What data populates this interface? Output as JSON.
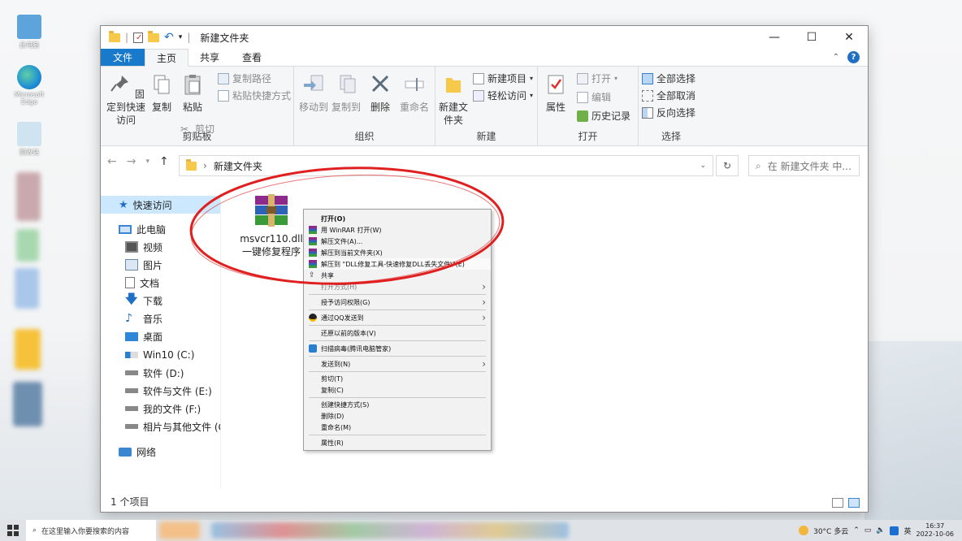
{
  "desktop": {
    "icons": [
      {
        "label": "此电脑",
        "color": "#5ea4dc"
      },
      {
        "label": "Microsoft Edge",
        "color": "#1f8fd6"
      },
      {
        "label": "回收站",
        "color": "#7fb6d8"
      }
    ]
  },
  "window": {
    "title": "新建文件夹",
    "controls": {
      "minimize": "—",
      "maximize": "☐",
      "close": "✕"
    }
  },
  "tabs": [
    "文件",
    "主页",
    "共享",
    "查看"
  ],
  "ribbon": {
    "clipboard": {
      "label": "剪贴板",
      "pin": "固定到快速访问",
      "copy": "复制",
      "paste": "粘贴",
      "copy_path": "复制路径",
      "paste_shortcut": "粘贴快捷方式",
      "cut": "剪切"
    },
    "organize": {
      "label": "组织",
      "move_to": "移动到",
      "copy_to": "复制到",
      "delete": "删除",
      "rename": "重命名"
    },
    "new": {
      "label": "新建",
      "new_folder": "新建文件夹",
      "new_item": "新建项目",
      "easy_access": "轻松访问"
    },
    "open": {
      "label": "打开",
      "properties": "属性",
      "open": "打开",
      "edit": "编辑",
      "history": "历史记录"
    },
    "select": {
      "label": "选择",
      "select_all": "全部选择",
      "select_none": "全部取消",
      "invert": "反向选择"
    }
  },
  "address": {
    "path": "新建文件夹",
    "search_placeholder": "在 新建文件夹 中..."
  },
  "sidebar": {
    "items": [
      {
        "label": "快速访问",
        "level": 0
      },
      {
        "label": "此电脑",
        "level": 0
      },
      {
        "label": "视频",
        "level": 1
      },
      {
        "label": "图片",
        "level": 1
      },
      {
        "label": "文档",
        "level": 1
      },
      {
        "label": "下载",
        "level": 1
      },
      {
        "label": "音乐",
        "level": 1
      },
      {
        "label": "桌面",
        "level": 1
      },
      {
        "label": "Win10 (C:)",
        "level": 1
      },
      {
        "label": "软件 (D:)",
        "level": 1
      },
      {
        "label": "软件与文件 (E:)",
        "level": 1
      },
      {
        "label": "我的文件 (F:)",
        "level": 1
      },
      {
        "label": "相片与其他文件 (G:",
        "level": 1
      },
      {
        "label": "网络",
        "level": 0
      }
    ]
  },
  "file": {
    "name_line1": "msvcr110.dll",
    "name_line2": "一键修复程序"
  },
  "context_menu": {
    "items": [
      {
        "label": "打开(O)",
        "bold": true
      },
      {
        "label": "用 WinRAR 打开(W)"
      },
      {
        "label": "解压文件(A)..."
      },
      {
        "label": "解压到当前文件夹(X)"
      },
      {
        "label": "解压到 \"DLL修复工具-快速修复DLL丢失文件\\\"(E)"
      },
      {
        "label": "共享"
      },
      {
        "label": "打开方式(H)"
      },
      {
        "label": "授予访问权限(G)"
      },
      {
        "label": "通过QQ发送到"
      },
      {
        "label": "还原以前的版本(V)"
      },
      {
        "label": "扫描病毒(腾讯电脑管家)"
      },
      {
        "label": "发送到(N)"
      },
      {
        "label": "剪切(T)"
      },
      {
        "label": "复制(C)"
      },
      {
        "label": "创建快捷方式(S)"
      },
      {
        "label": "删除(D)"
      },
      {
        "label": "重命名(M)"
      },
      {
        "label": "属性(R)"
      }
    ]
  },
  "status": {
    "count": "1 个项目"
  },
  "taskbar": {
    "search_placeholder": "在这里输入你要搜索的内容",
    "weather": "30°C 多云",
    "ime": "英",
    "time": "16:37",
    "date": "2022-10-06"
  },
  "colors": {
    "accent": "#1979ca",
    "annotation": "#e02020",
    "selection": "#cce8ff"
  }
}
